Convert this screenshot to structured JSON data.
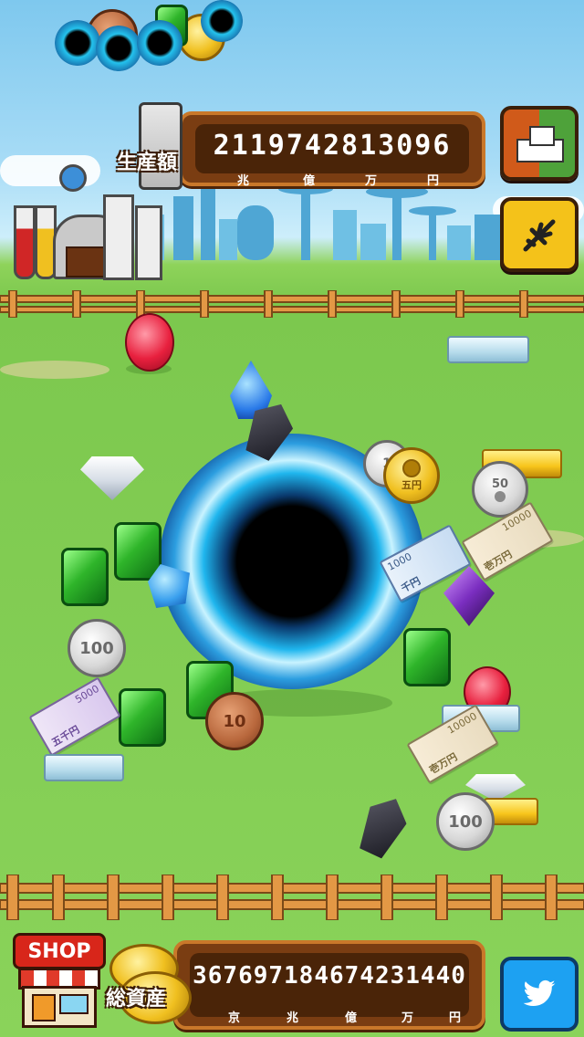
{
  "production": {
    "label": "生産額",
    "value": "2119742813096",
    "units": [
      "兆",
      "億",
      "万",
      "円"
    ]
  },
  "assets": {
    "label": "総資産",
    "value": "3676971846742​31440",
    "units": [
      "京",
      "兆",
      "億",
      "万",
      "円"
    ]
  },
  "shop": {
    "label": "SHOP"
  },
  "coins": {
    "c100a": "100",
    "c100b": "100",
    "c50": "50",
    "c10": "10",
    "c5": "五円",
    "c1": "1"
  },
  "bills": {
    "b5000": "五千円",
    "b1000": "千円",
    "b10000a": "壱万円",
    "b10000b": "壱万円",
    "b1000_small": "1000",
    "b5000_small": "5000",
    "b10000_small": "10000"
  },
  "colors": {
    "sky": "#7ec8ee",
    "grass": "#8ad35a",
    "panel": "#7a3d12",
    "twitter": "#1da1f2",
    "plane_button": "#f4c21a"
  },
  "icons": {
    "blocks": "blocks-icon",
    "plane": "plane-icon",
    "twitter": "twitter-icon"
  }
}
